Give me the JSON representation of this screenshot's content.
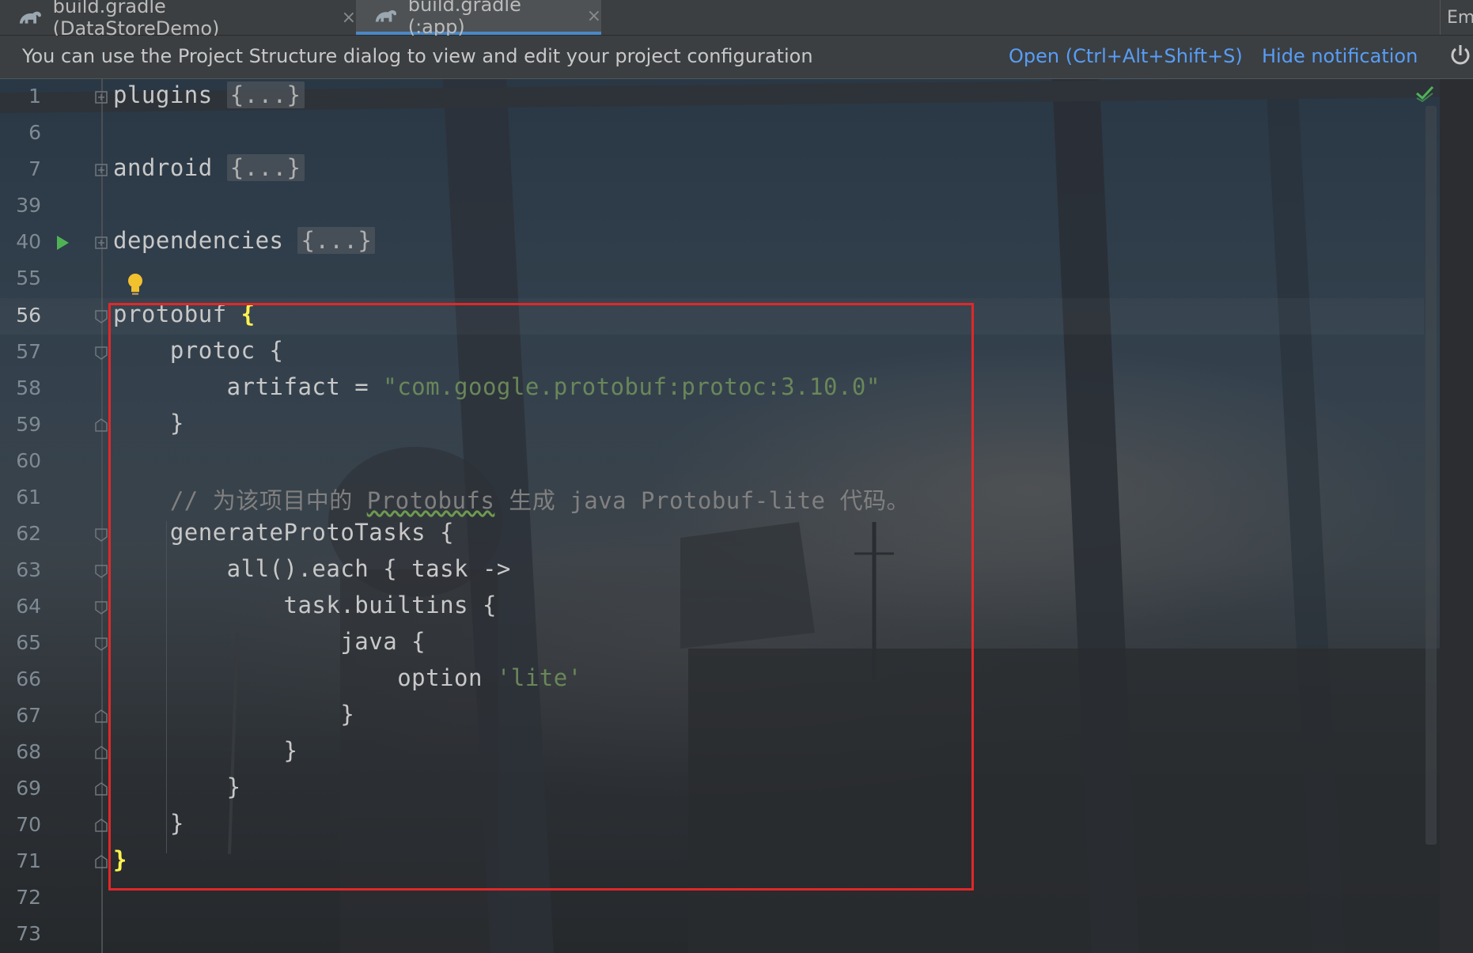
{
  "tabs": [
    {
      "label": "build.gradle (DataStoreDemo)",
      "close": "×",
      "active": false
    },
    {
      "label": "build.gradle (:app)",
      "close": "×",
      "active": true
    }
  ],
  "tab_overflow_label": "Em",
  "notification": {
    "message": "You can use the Project Structure dialog to view and edit your project configuration",
    "open_link": "Open (Ctrl+Alt+Shift+S)",
    "hide_link": "Hide notification"
  },
  "editor": {
    "current_line": "56",
    "lines": [
      {
        "num": "1",
        "keyword": "plugins",
        "folded": "{...}"
      },
      {
        "num": "6"
      },
      {
        "num": "7",
        "keyword": "android",
        "folded": "{...}"
      },
      {
        "num": "39"
      },
      {
        "num": "40",
        "keyword": "dependencies",
        "folded": "{...}"
      },
      {
        "num": "55"
      },
      {
        "num": "56",
        "text": "protobuf ",
        "brace": "{"
      },
      {
        "num": "57",
        "text": "    protoc {"
      },
      {
        "num": "58",
        "text": "        artifact = ",
        "string": "\"com.google.protobuf:protoc:3.10.0\""
      },
      {
        "num": "59",
        "text": "    }"
      },
      {
        "num": "60"
      },
      {
        "num": "61",
        "comment_prefix": "    // 为该项目中的 ",
        "comment_word": "Protobufs",
        "comment_suffix": " 生成 java Protobuf-lite 代码。"
      },
      {
        "num": "62",
        "text": "    generateProtoTasks {"
      },
      {
        "num": "63",
        "text": "        all().each { task ->"
      },
      {
        "num": "64",
        "text": "            task.builtins {"
      },
      {
        "num": "65",
        "text": "                java {"
      },
      {
        "num": "66",
        "text": "                    option ",
        "string": "'lite'"
      },
      {
        "num": "67",
        "text": "                }"
      },
      {
        "num": "68",
        "text": "            }"
      },
      {
        "num": "69",
        "text": "        }"
      },
      {
        "num": "70",
        "text": "    }"
      },
      {
        "num": "71",
        "brace": "}"
      },
      {
        "num": "72"
      },
      {
        "num": "73"
      }
    ]
  }
}
